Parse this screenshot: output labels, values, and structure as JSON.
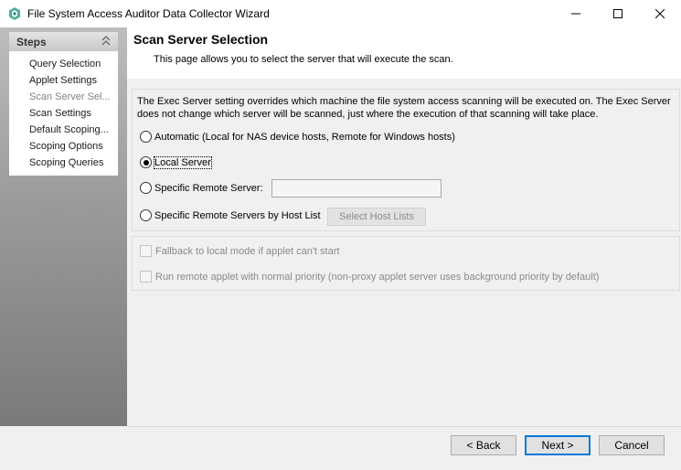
{
  "window": {
    "title": "File System Access Auditor Data Collector Wizard",
    "accent_color": "#0078d7"
  },
  "sidebar": {
    "title": "Steps",
    "items": [
      {
        "label": "Query Selection"
      },
      {
        "label": "Applet Settings"
      },
      {
        "label": "Scan Server Sel..."
      },
      {
        "label": "Scan Settings"
      },
      {
        "label": "Default Scoping..."
      },
      {
        "label": "Scoping Options"
      },
      {
        "label": "Scoping Queries"
      }
    ]
  },
  "header": {
    "title": "Scan Server Selection",
    "description": "This page allows you to select the server that will execute the scan."
  },
  "exec_group": {
    "info": "The Exec Server setting overrides which machine the file system access scanning will be executed on. The Exec Server does not change which server will be scanned, just where the execution of that scanning will take place.",
    "options": [
      {
        "label": "Automatic (Local for NAS device hosts, Remote for Windows hosts)"
      },
      {
        "label": "Local Server"
      },
      {
        "label": "Specific Remote Server:"
      },
      {
        "label": "Specific Remote Servers by Host List"
      }
    ],
    "selected": "Local Server",
    "remote_server_value": "",
    "host_list_button": "Select Host Lists"
  },
  "options_group": {
    "checkboxes": [
      {
        "label": "Fallback to local mode if applet can't start",
        "checked": false
      },
      {
        "label": "Run remote applet with normal priority (non-proxy applet server uses background priority by default)",
        "checked": false
      }
    ]
  },
  "footer": {
    "back": "< Back",
    "next": "Next >",
    "cancel": "Cancel"
  }
}
